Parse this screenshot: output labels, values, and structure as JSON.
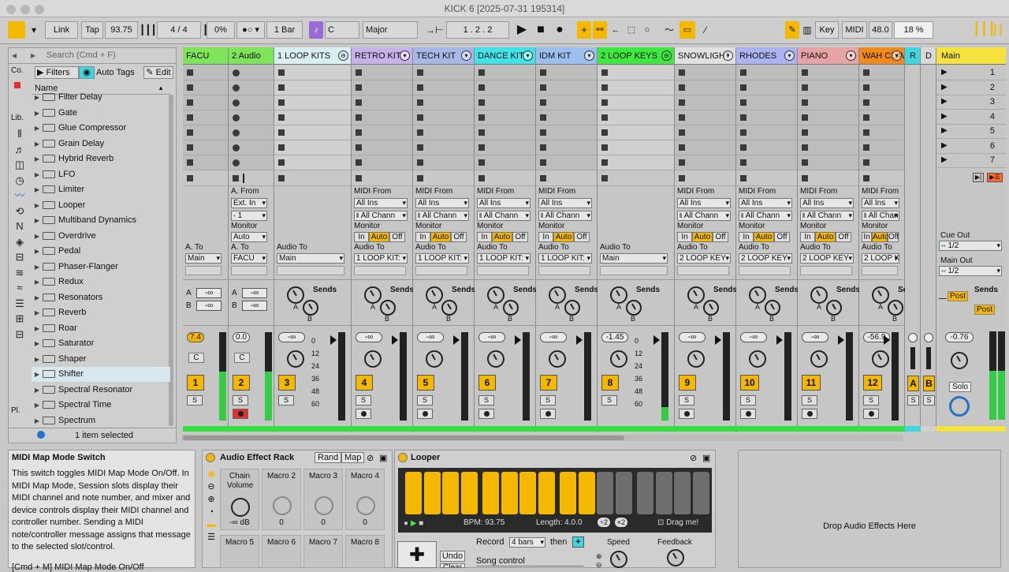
{
  "window": {
    "title": "KICK 6 [2025-07-31 195314]"
  },
  "toolbar": {
    "link": "Link",
    "tap": "Tap",
    "bpm": "93.75",
    "sig": "4 / 4",
    "swing": "0%",
    "quant": "1 Bar",
    "key_root": "C",
    "scale": "Major",
    "position": "1 .  2 .  2",
    "key_label": "Key",
    "midi_label": "MIDI",
    "rate": "48.0",
    "cpu": "18 %"
  },
  "browser": {
    "search_placeholder": "Search (Cmd + F)",
    "filters": "Filters",
    "auto_tags": "Auto Tags",
    "edit": "Edit",
    "col_name": "Name",
    "status": "1 item selected",
    "side_labels": [
      "Co.",
      "Lib.",
      "Pl."
    ],
    "items": [
      "Filter Delay",
      "Gate",
      "Glue Compressor",
      "Grain Delay",
      "Hybrid Reverb",
      "LFO",
      "Limiter",
      "Looper",
      "Multiband Dynamics",
      "Overdrive",
      "Pedal",
      "Phaser-Flanger",
      "Redux",
      "Resonators",
      "Reverb",
      "Roar",
      "Saturator",
      "Shaper",
      "Shifter",
      "Spectral Resonator",
      "Spectral Time",
      "Spectrum"
    ]
  },
  "tracks": [
    {
      "name": "FACU",
      "color": "#7ee45a",
      "kind": "audio_simple",
      "vol": "7.4",
      "vol_yellow": true,
      "num": "1",
      "meter": 0.55,
      "to_label": "A. To",
      "to": "Main",
      "sendA": "-∞",
      "sendB": "-∞"
    },
    {
      "name": "2 Audio",
      "color": "#7ee45a",
      "kind": "audio_from",
      "vol": "0.0",
      "num": "2",
      "meter": 0.55,
      "from_label": "A. From",
      "from": "Ext. In",
      "ch": "1",
      "mon_label": "Monitor",
      "mon": "Auto",
      "to_label": "A. To",
      "to": "FACU",
      "sendA": "-∞",
      "sendB": "-∞",
      "armed": true
    },
    {
      "name": "1 LOOP KITS",
      "color": "#d8eef3",
      "kind": "group",
      "vol": "-∞",
      "num": "3",
      "to_label": "Audio To",
      "to": "Main"
    },
    {
      "name": "RETRO KIT",
      "color": "#c9b0e8",
      "kind": "midi",
      "vol": "-∞",
      "num": "4",
      "to": "1 LOOP KIT:"
    },
    {
      "name": "TECH KIT",
      "color": "#a6b7e8",
      "kind": "midi",
      "vol": "-∞",
      "num": "5",
      "to": "1 LOOP KIT:"
    },
    {
      "name": "DANCE KIT",
      "color": "#3fe3e8",
      "kind": "midi",
      "vol": "-∞",
      "num": "6",
      "to": "1 LOOP KIT:"
    },
    {
      "name": "IDM KIT",
      "color": "#9bc0ee",
      "kind": "midi",
      "vol": "-∞",
      "num": "7",
      "to": "1 LOOP KIT:"
    },
    {
      "name": "2 LOOP KEYS",
      "color": "#3ee83e",
      "kind": "group",
      "vol": "-1.45",
      "num": "8",
      "to_label": "Audio To",
      "to": "Main",
      "meter": 0.15
    },
    {
      "name": "SNOWLIGHT",
      "color": "#e0e0e0",
      "kind": "midi",
      "vol": "-∞",
      "num": "9",
      "to": "2 LOOP KEY"
    },
    {
      "name": "RHODES",
      "color": "#aab4f0",
      "kind": "midi",
      "vol": "-∞",
      "num": "10",
      "to": "2 LOOP KEY"
    },
    {
      "name": "PIANO",
      "color": "#e7a4a4",
      "kind": "midi",
      "vol": "-∞",
      "num": "11",
      "to": "2 LOOP KEY"
    },
    {
      "name": "WAH CLAV",
      "color": "#f08a1c",
      "kind": "midi",
      "vol": "-56.9",
      "num": "12",
      "to": "2 LOOP KEY"
    }
  ],
  "midi_labels": {
    "from": "MIDI From",
    "ins": "All Ins",
    "chan": "All Chann",
    "monitor": "Monitor",
    "in": "In",
    "auto": "Auto",
    "off": "Off",
    "audio_to": "Audio To",
    "sends": "Sends"
  },
  "returns": [
    {
      "name": "R",
      "letter": "A"
    },
    {
      "name": "D",
      "letter": "B"
    }
  ],
  "master": {
    "name": "Main",
    "scenes": [
      "1",
      "2",
      "3",
      "4",
      "5",
      "6",
      "7"
    ],
    "cue_label": "Cue Out",
    "cue": "1/2",
    "main_label": "Main Out",
    "main_out": "1/2",
    "sends": "Sends",
    "post": "Post",
    "vol": "-0.76",
    "solo": "Solo"
  },
  "info": {
    "title": "MIDI Map Mode Switch",
    "body": "This switch toggles MIDI Map Mode On/Off. In MIDI Map Mode, Session slots display their MIDI channel and note number, and mixer and device controls display their MIDI channel and controller number. Sending a MIDI note/controller message assigns that message to the selected slot/control.",
    "footer": "[Cmd + M] MIDI Map Mode On/Off"
  },
  "rack": {
    "title": "Audio Effect Rack",
    "rand": "Rand",
    "map": "Map",
    "chain_volume": "Chain Volume",
    "chain_value": "-∞ dB",
    "macros": [
      "Macro 2",
      "Macro 3",
      "Macro 4",
      "Macro 5",
      "Macro 6",
      "Macro 7",
      "Macro 8"
    ],
    "macro_value": "0"
  },
  "looper": {
    "title": "Looper",
    "bpm": "BPM: 93.75",
    "length": "Length: 4.0.0",
    "half": "÷2",
    "double": "×2",
    "drag": "Drag me!",
    "record": "Record",
    "bars": "4 bars",
    "then": "then",
    "song_control": "Song control",
    "undo": "Undo",
    "clear": "Clear",
    "speed": "Speed",
    "feedback": "Feedback"
  },
  "drop": {
    "text": "Drop Audio Effects Here"
  },
  "colors": {
    "accent": "#f5b800",
    "green": "#33e040"
  }
}
